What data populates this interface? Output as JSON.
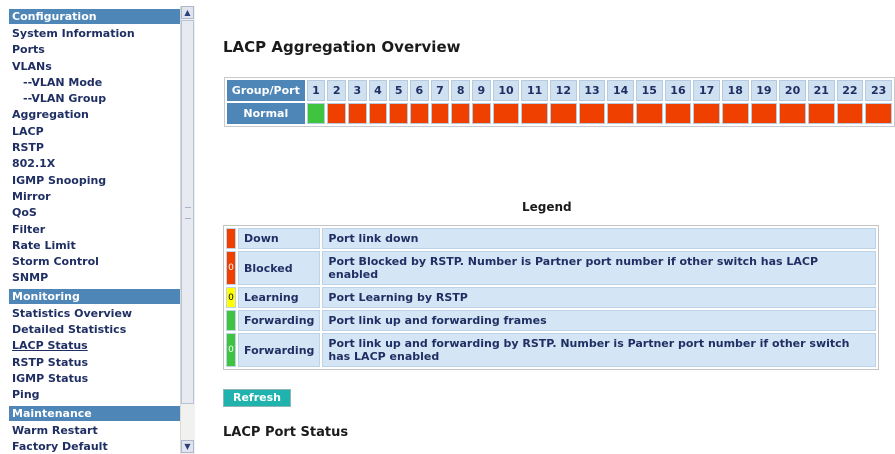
{
  "sidebar": {
    "entries": [
      {
        "kind": "section",
        "label": "Configuration"
      },
      {
        "kind": "item",
        "label": "System Information"
      },
      {
        "kind": "item",
        "label": "Ports"
      },
      {
        "kind": "item",
        "label": "VLANs"
      },
      {
        "kind": "sub",
        "label": "--VLAN Mode"
      },
      {
        "kind": "sub",
        "label": "--VLAN Group"
      },
      {
        "kind": "item",
        "label": "Aggregation"
      },
      {
        "kind": "item",
        "label": "LACP"
      },
      {
        "kind": "item",
        "label": "RSTP"
      },
      {
        "kind": "item",
        "label": "802.1X"
      },
      {
        "kind": "item",
        "label": "IGMP Snooping"
      },
      {
        "kind": "item",
        "label": "Mirror"
      },
      {
        "kind": "item",
        "label": "QoS"
      },
      {
        "kind": "item",
        "label": "Filter"
      },
      {
        "kind": "item",
        "label": "Rate Limit"
      },
      {
        "kind": "item",
        "label": "Storm Control"
      },
      {
        "kind": "item",
        "label": "SNMP"
      },
      {
        "kind": "section",
        "label": "Monitoring"
      },
      {
        "kind": "item",
        "label": "Statistics Overview"
      },
      {
        "kind": "item",
        "label": "Detailed Statistics"
      },
      {
        "kind": "item",
        "label": "LACP Status",
        "active": true
      },
      {
        "kind": "item",
        "label": "RSTP Status"
      },
      {
        "kind": "item",
        "label": "IGMP Status"
      },
      {
        "kind": "item",
        "label": "Ping"
      },
      {
        "kind": "section",
        "label": "Maintenance"
      },
      {
        "kind": "item",
        "label": "Warm Restart"
      },
      {
        "kind": "item",
        "label": "Factory Default"
      }
    ],
    "scroll_up_icon": "scroll-up-arrow-icon",
    "scroll_down_icon": "scroll-down-arrow-icon"
  },
  "main": {
    "title": "LACP Aggregation Overview",
    "aggregation": {
      "header_label": "Group/Port",
      "row_label": "Normal",
      "ports": [
        "1",
        "2",
        "3",
        "4",
        "5",
        "6",
        "7",
        "8",
        "9",
        "10",
        "11",
        "12",
        "13",
        "14",
        "15",
        "16",
        "17",
        "18",
        "19",
        "20",
        "21",
        "22",
        "23"
      ],
      "states": [
        "forwarding",
        "down",
        "down",
        "down",
        "down",
        "down",
        "down",
        "down",
        "down",
        "down",
        "down",
        "down",
        "down",
        "down",
        "down",
        "down",
        "down",
        "down",
        "down",
        "down",
        "down",
        "down",
        "down"
      ]
    },
    "legend": {
      "title": "Legend",
      "rows": [
        {
          "color": "#f04000",
          "num": "",
          "state": "Down",
          "desc": "Port link down"
        },
        {
          "color": "#f04000",
          "num": "0",
          "state": "Blocked",
          "desc": "Port Blocked by RSTP. Number is Partner port number if other switch has LACP enabled"
        },
        {
          "color": "#ffff00",
          "num": "0",
          "state": "Learning",
          "desc": "Port Learning by RSTP"
        },
        {
          "color": "#3ec43e",
          "num": "",
          "state": "Forwarding",
          "desc": "Port link up and forwarding frames"
        },
        {
          "color": "#3ec43e",
          "num": "0",
          "state": "Forwarding",
          "desc": "Port link up and forwarding by RSTP. Number is Partner port number if other switch has LACP enabled"
        }
      ]
    },
    "refresh_label": "Refresh",
    "port_status_title": "LACP Port Status"
  },
  "colors": {
    "down": "#f04000",
    "forwarding": "#3ec43e",
    "learning": "#ffff00",
    "header_blue": "#4e86b8",
    "cell_light_blue": "#d4e6f5",
    "refresh_teal": "#20b3ad"
  }
}
